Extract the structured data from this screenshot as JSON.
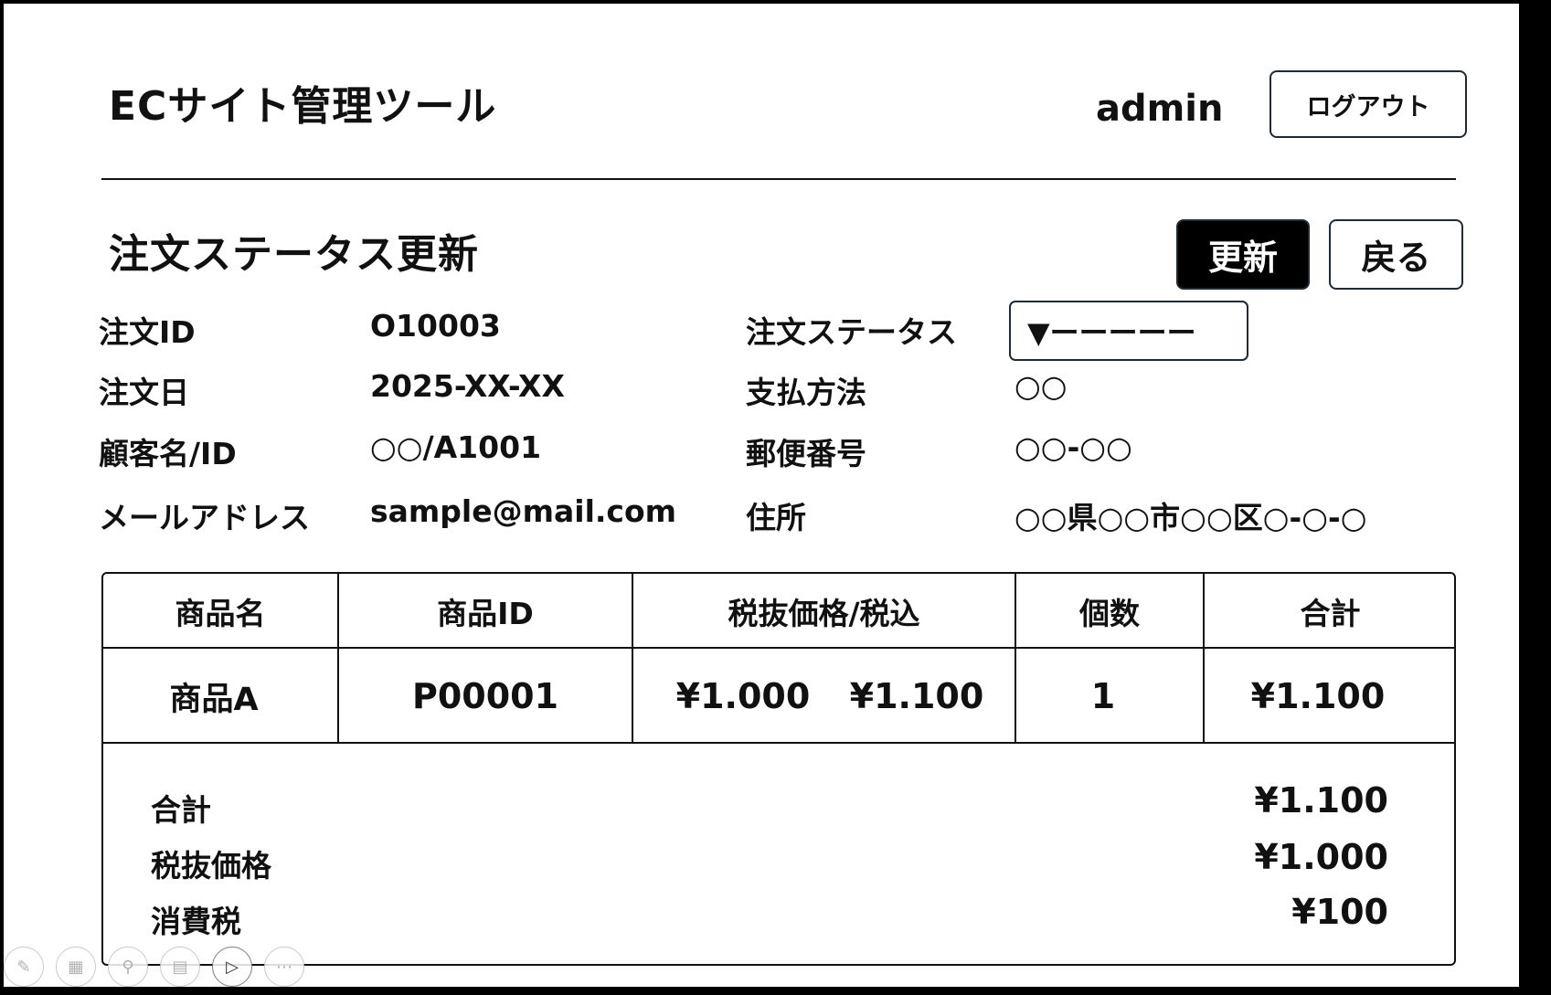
{
  "header": {
    "app_title": "ECサイト管理ツール",
    "user": "admin",
    "logout_label": "ログアウト"
  },
  "page": {
    "title": "注文ステータス更新",
    "update_label": "更新",
    "back_label": "戻る"
  },
  "order": {
    "order_id_label": "注文ID",
    "order_id": "O10003",
    "order_date_label": "注文日",
    "order_date": "2025-XX-XX",
    "customer_label": "顧客名/ID",
    "customer": "○○/A1001",
    "email_label": "メールアドレス",
    "email": "sample@mail.com",
    "status_label": "注文ステータス",
    "status_value": "▼ーーーーー",
    "payment_label": "支払方法",
    "payment": "○○",
    "postal_label": "郵便番号",
    "postal": "○○-○○",
    "address_label": "住所",
    "address": "○○県○○市○○区○-○-○"
  },
  "table": {
    "headers": [
      "商品名",
      "商品ID",
      "税抜価格/税込",
      "個数",
      "合計"
    ],
    "rows": [
      {
        "name": "商品A",
        "id": "P00001",
        "price_ex_tax": "¥1.000",
        "price_in_tax": "¥1.100",
        "quantity": "1",
        "total": "¥1.100"
      }
    ]
  },
  "summary": {
    "total_label": "合計",
    "total": "¥1.100",
    "ex_tax_label": "税抜価格",
    "ex_tax": "¥1.000",
    "tax_label": "消費税",
    "tax": "¥100"
  },
  "toolbar": {
    "icons": [
      "pen-icon",
      "slides-icon",
      "zoom-icon",
      "subtitles-icon",
      "camera-icon",
      "more-icon"
    ]
  }
}
